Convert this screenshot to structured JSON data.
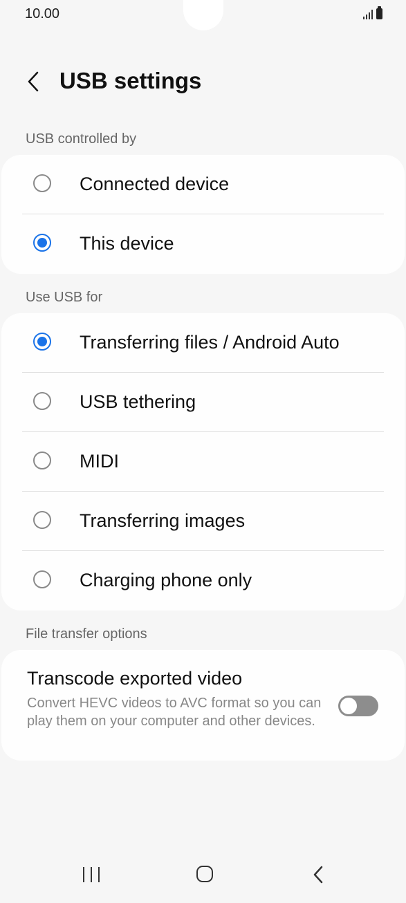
{
  "status_bar": {
    "time": "10.00"
  },
  "header": {
    "title": "USB settings"
  },
  "usb_controlled_by": {
    "label": "USB controlled by",
    "options": [
      {
        "label": "Connected device",
        "selected": false
      },
      {
        "label": "This device",
        "selected": true
      }
    ]
  },
  "use_usb_for": {
    "label": "Use USB for",
    "options": [
      {
        "label": "Transferring files / Android Auto",
        "selected": true
      },
      {
        "label": "USB tethering",
        "selected": false
      },
      {
        "label": "MIDI",
        "selected": false
      },
      {
        "label": "Transferring images",
        "selected": false
      },
      {
        "label": "Charging phone only",
        "selected": false
      }
    ]
  },
  "file_transfer": {
    "label": "File transfer options",
    "transcode_title": "Transcode exported video",
    "transcode_desc": "Convert HEVC videos to AVC format so you can play them on your computer and other devices.",
    "transcode_enabled": false
  },
  "colors": {
    "accent": "#1a73e8",
    "background": "#f6f6f6",
    "card": "#fefefe"
  }
}
